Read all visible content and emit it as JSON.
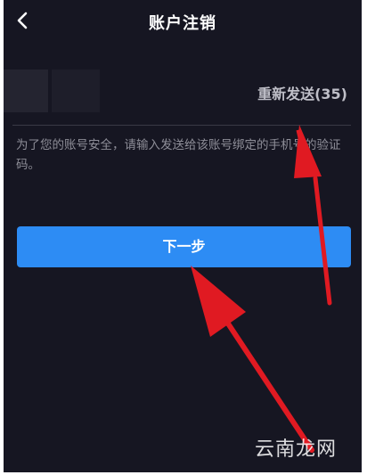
{
  "nav": {
    "title": "账户注销",
    "back_icon": "chevron-left-icon"
  },
  "code": {
    "resend_label": "重新发送(35)"
  },
  "hint": {
    "text": "为了您的账号安全，请输入发送给该账号绑定的手机号的验证码。"
  },
  "actions": {
    "next_label": "下一步"
  },
  "watermark": {
    "text": "云南龙网"
  },
  "colors": {
    "background": "#161622",
    "button": "#2d8cf4",
    "arrow": "#e01a22"
  }
}
